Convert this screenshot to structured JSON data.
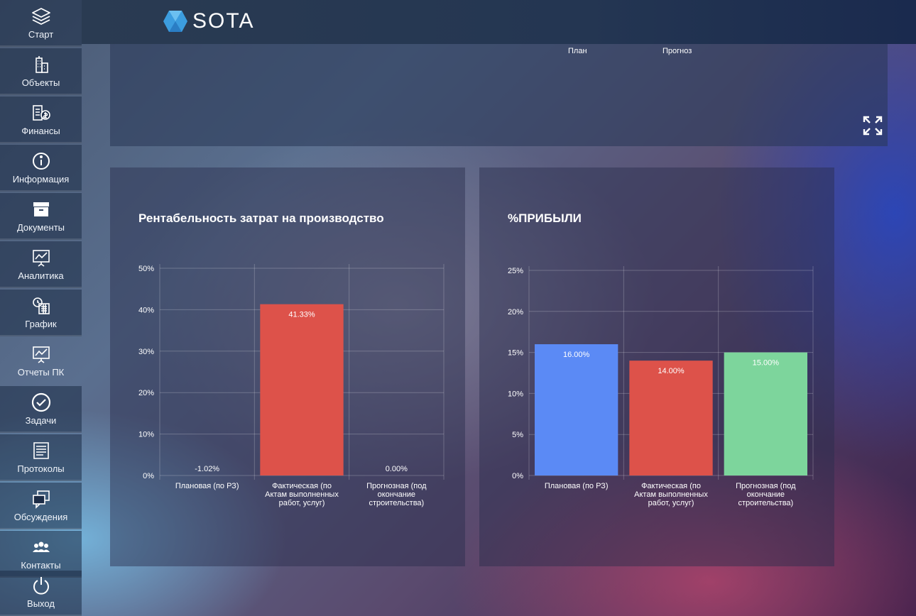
{
  "app": {
    "logo_text": "SOTA"
  },
  "sidebar": {
    "items": [
      {
        "label": "Старт",
        "icon": "layers-icon"
      },
      {
        "label": "Объекты",
        "icon": "buildings-icon"
      },
      {
        "label": "Финансы",
        "icon": "finance-icon"
      },
      {
        "label": "Информация",
        "icon": "info-icon"
      },
      {
        "label": "Документы",
        "icon": "archive-box-icon"
      },
      {
        "label": "Аналитика",
        "icon": "presentation-chart-icon"
      },
      {
        "label": "График",
        "icon": "calendar-clock-icon"
      },
      {
        "label": "Отчеты ПК",
        "icon": "report-board-icon",
        "active": true
      },
      {
        "label": "Задачи",
        "icon": "check-circle-icon"
      },
      {
        "label": "Протоколы",
        "icon": "document-list-icon"
      },
      {
        "label": "Обсуждения",
        "icon": "chat-windows-icon"
      },
      {
        "label": "Контакты",
        "icon": "contacts-group-icon"
      },
      {
        "label": "Выход",
        "icon": "power-icon"
      }
    ]
  },
  "top_panel": {
    "legend": [
      "План",
      "Прогноз"
    ],
    "expand_icon": "expand-icon"
  },
  "charts": {
    "left_title": "Рентабельность затрат на производство",
    "right_title": "%ПРИБЫЛИ"
  },
  "chart_data": [
    {
      "type": "bar",
      "title": "Рентабельность затрат на производство",
      "categories": [
        "Плановая (по РЗ)",
        "Фактическая (по Актам выполненных работ, услуг)",
        "Прогнозная (под окончание строительства)"
      ],
      "category_lines": [
        [
          "Плановая (по РЗ)"
        ],
        [
          "Фактическая (по",
          "Актам выполненных",
          "работ, услуг)"
        ],
        [
          "Прогнозная (под",
          "окончание",
          "строительства)"
        ]
      ],
      "values": [
        -1.02,
        41.33,
        0.0
      ],
      "data_labels": [
        "-1.02%",
        "41.33%",
        "0.00%"
      ],
      "colors": [
        "#5b8af5",
        "#dd524a",
        "#7dd59c"
      ],
      "ylim": [
        0,
        50
      ],
      "yticks": [
        "0%",
        "10%",
        "20%",
        "30%",
        "40%",
        "50%"
      ],
      "grid": true
    },
    {
      "type": "bar",
      "title": "%ПРИБЫЛИ",
      "categories": [
        "Плановая (по РЗ)",
        "Фактическая (по Актам выполненных работ, услуг)",
        "Прогнозная (под окончание строительства)"
      ],
      "category_lines": [
        [
          "Плановая (по РЗ)"
        ],
        [
          "Фактическая (по",
          "Актам выполненных",
          "работ, услуг)"
        ],
        [
          "Прогнозная (под",
          "окончание",
          "строительства)"
        ]
      ],
      "values": [
        16.0,
        14.0,
        15.0
      ],
      "data_labels": [
        "16.00%",
        "14.00%",
        "15.00%"
      ],
      "colors": [
        "#5b8af5",
        "#dd524a",
        "#7dd59c"
      ],
      "ylim": [
        0,
        25
      ],
      "yticks": [
        "0%",
        "5%",
        "10%",
        "15%",
        "20%",
        "25%"
      ],
      "grid": true
    }
  ]
}
